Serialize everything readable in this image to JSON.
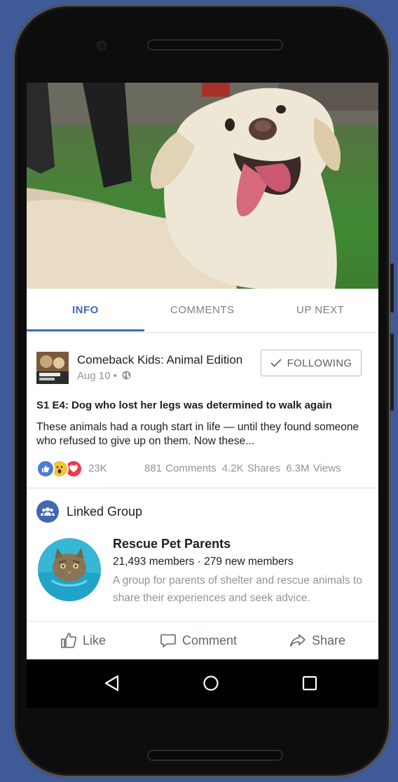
{
  "tabs": [
    {
      "label": "INFO",
      "active": true
    },
    {
      "label": "COMMENTS",
      "active": false
    },
    {
      "label": "UP NEXT",
      "active": false
    }
  ],
  "post": {
    "page_name": "Comeback Kids: Animal Edition",
    "date": "Aug 10 •",
    "privacy_icon": "globe-icon",
    "follow_label": "FOLLOWING",
    "title": "S1 E4: Dog who lost her legs was determined to walk again",
    "description": "These animals had a rough start in life — until they found someone who refused to give up on them. Now these...",
    "reaction_icons": [
      "like-icon",
      "wow-icon",
      "love-icon"
    ],
    "reaction_count": "23K",
    "comments": "881 Comments",
    "shares": "4.2K Shares",
    "views": "6.3M Views"
  },
  "linked_group": {
    "section_title": "Linked Group",
    "name": "Rescue Pet Parents",
    "members": "21,493 members · 279 new members",
    "description": "A group for parents of shelter and rescue animals to share their experiences and seek advice."
  },
  "actions": {
    "like": "Like",
    "comment": "Comment",
    "share": "Share"
  },
  "colors": {
    "brand_blue": "#4267b2",
    "background": "#3f5a98",
    "muted_text": "#90949c"
  }
}
